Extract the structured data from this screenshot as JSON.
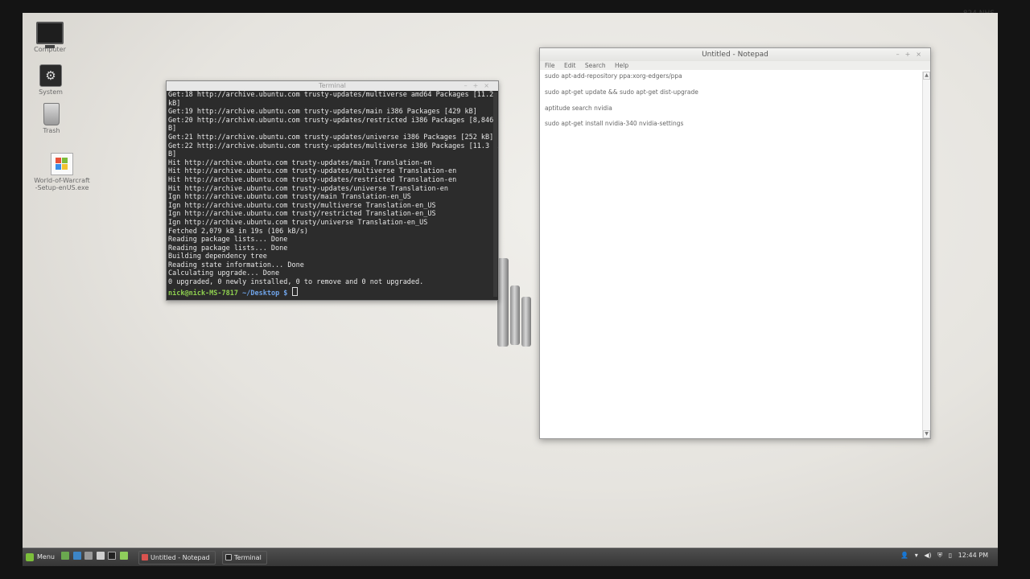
{
  "monitor_label": "824 NHS",
  "desktop_icons": [
    {
      "label": "Computer",
      "icon": "computer-icon"
    },
    {
      "label": "System",
      "icon": "system-icon"
    },
    {
      "label": "Trash",
      "icon": "trash-icon"
    },
    {
      "label": "World-of-Warcraft-Setup-enUS.exe",
      "icon": "installer-icon"
    }
  ],
  "terminal": {
    "title": "Terminal",
    "lines": [
      "Get:18 http://archive.ubuntu.com trusty-updates/multiverse amd64 Packages [11.2",
      "kB]",
      "Get:19 http://archive.ubuntu.com trusty-updates/main i386 Packages [429 kB]",
      "Get:20 http://archive.ubuntu.com trusty-updates/restricted i386 Packages [8,846",
      "B]",
      "Get:21 http://archive.ubuntu.com trusty-updates/universe i386 Packages [252 kB]",
      "Get:22 http://archive.ubuntu.com trusty-updates/multiverse i386 Packages [11.3 k",
      "B]",
      "Hit http://archive.ubuntu.com trusty-updates/main Translation-en",
      "Hit http://archive.ubuntu.com trusty-updates/multiverse Translation-en",
      "Hit http://archive.ubuntu.com trusty-updates/restricted Translation-en",
      "Hit http://archive.ubuntu.com trusty-updates/universe Translation-en",
      "Ign http://archive.ubuntu.com trusty/main Translation-en_US",
      "Ign http://archive.ubuntu.com trusty/multiverse Translation-en_US",
      "Ign http://archive.ubuntu.com trusty/restricted Translation-en_US",
      "Ign http://archive.ubuntu.com trusty/universe Translation-en_US",
      "Fetched 2,079 kB in 19s (106 kB/s)",
      "Reading package lists... Done",
      "Reading package lists... Done",
      "Building dependency tree",
      "Reading state information... Done",
      "Calculating upgrade... Done",
      "0 upgraded, 0 newly installed, 0 to remove and 0 not upgraded."
    ],
    "prompt_user": "nick@nick-MS-7817",
    "prompt_path": "~/Desktop $"
  },
  "notepad": {
    "title": "Untitled - Notepad",
    "menu": [
      "File",
      "Edit",
      "Search",
      "Help"
    ],
    "lines": [
      "sudo apt-add-repository ppa:xorg-edgers/ppa",
      "sudo apt-get update && sudo apt-get dist-upgrade",
      "aptitude search nvidia",
      "sudo apt-get install nvidia-340 nvidia-settings"
    ]
  },
  "taskbar": {
    "menu_label": "Menu",
    "tasks": [
      {
        "label": "Untitled - Notepad",
        "icon": "notepad-icon"
      },
      {
        "label": "Terminal",
        "icon": "terminal-icon"
      }
    ],
    "clock": "12:44 PM"
  },
  "colors": {
    "taskbar": "#3f3f3f",
    "terminal_bg": "#2c2c2c",
    "prompt_user": "#8fd14f",
    "prompt_path": "#6fa3e8"
  }
}
